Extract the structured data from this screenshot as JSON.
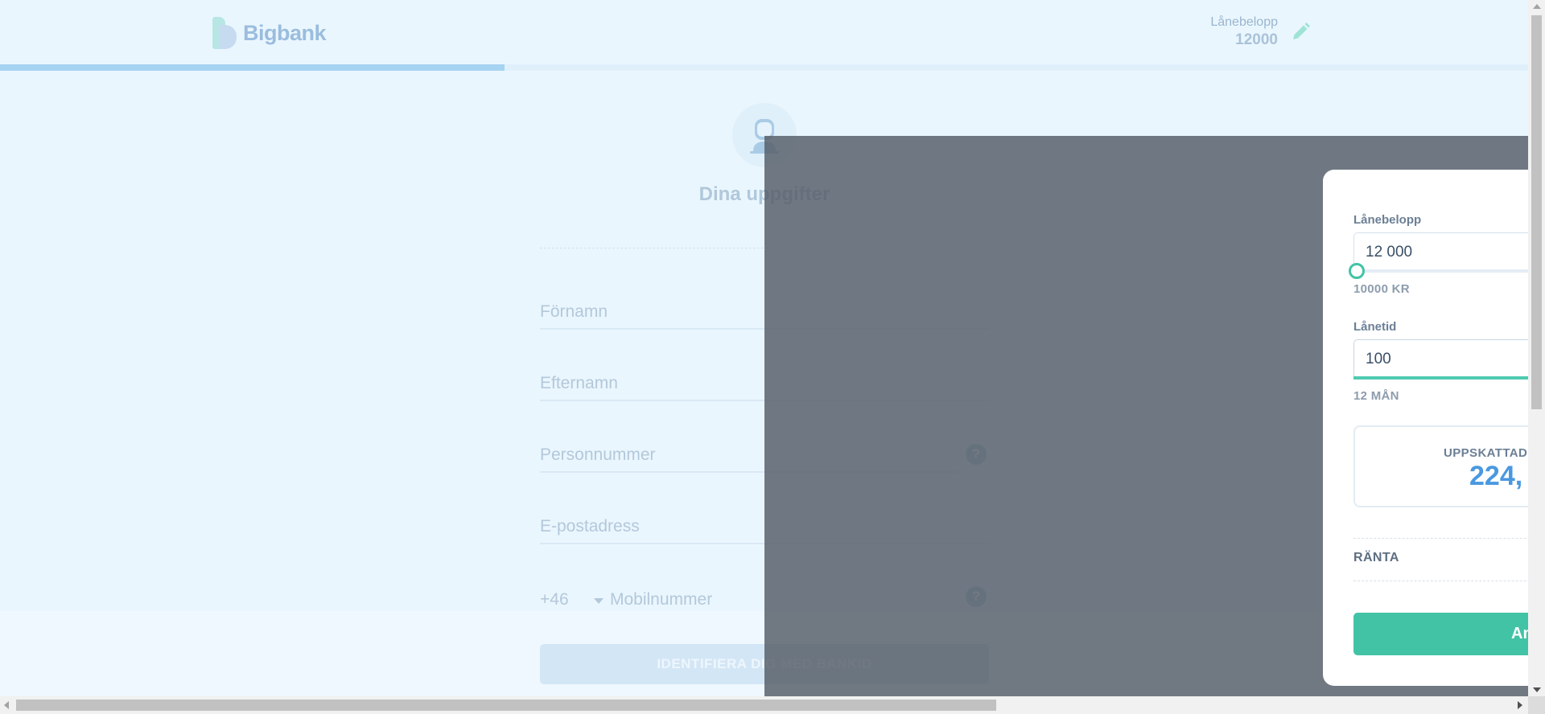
{
  "header": {
    "brand": "Bigbank",
    "loan_label": "Lånebelopp",
    "loan_value": "12000"
  },
  "progress": {
    "fraction": 0.33
  },
  "form": {
    "title": "Dina uppgifter",
    "first_name_placeholder": "Förnamn",
    "last_name_placeholder": "Efternamn",
    "personal_number_placeholder": "Personnummer",
    "email_placeholder": "E-postadress",
    "phone_prefix": "+46",
    "phone_placeholder": "Mobilnummer",
    "help_glyph": "?",
    "bankid_button": "IDENTIFIERA DIG MED BANKID"
  },
  "panel": {
    "amount_label": "Lånebelopp",
    "amount_value": "12 000",
    "amount_min": "10000 KR",
    "amount_slider_fraction": 0.0,
    "term_label": "Lånetid",
    "term_value": "100",
    "term_min": "12 MÅN",
    "term_slider_fraction": 1.0,
    "estimate_label": "UPPSKATTAD",
    "estimate_value": "224,",
    "interest_label": "RÄNTA",
    "apply_button": "An"
  },
  "colors": {
    "accent": "#42c3a6",
    "estimate": "#4a98e0",
    "page_bg": "#eaf6fe",
    "overlay": "#545c67"
  },
  "icons": {
    "edit": "pencil-icon",
    "person": "person-icon",
    "help": "help-icon"
  }
}
